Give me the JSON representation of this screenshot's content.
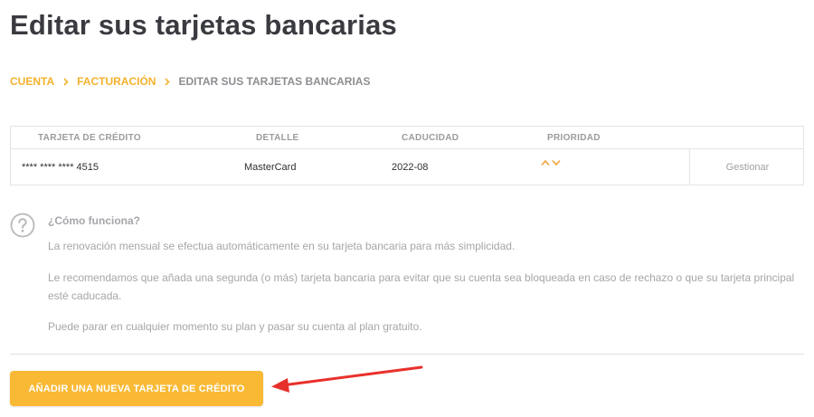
{
  "page": {
    "title": "Editar sus tarjetas bancarias"
  },
  "breadcrumb": {
    "items": [
      {
        "label": "CUENTA"
      },
      {
        "label": "FACTURACIÓN"
      },
      {
        "label": "EDITAR SUS TARJETAS BANCARIAS"
      }
    ]
  },
  "table": {
    "columns": [
      "TARJETA DE CRÉDITO",
      "DETALLE",
      "CADUCIDAD",
      "PRIORIDAD"
    ],
    "rows": [
      {
        "card_number": "**** **** **** 4515",
        "detail": "MasterCard",
        "expiry": "2022-08",
        "manage_label": "Gestionar"
      }
    ]
  },
  "help": {
    "icon": "question-circle-icon",
    "title": "¿Cómo funciona?",
    "paragraphs": [
      "La renovación mensual se efectua automáticamente en su tarjeta bancaria para más simplicidad.",
      "Le recomendamos que añada una segunda (o más) tarjeta bancaria para evitar que su cuenta sea bloqueada en caso de rechazo o que su tarjeta principal esté caducada.",
      "Puede parar en cualquier momento su plan y pasar su cuenta al plan gratuito."
    ]
  },
  "actions": {
    "add_card_label": "AÑADIR UNA NUEVA TARJETA DE CRÉDITO"
  },
  "colors": {
    "accent": "#f9b934",
    "breadcrumb_link": "#f5b12d",
    "priority_arrow": "#f0a23c",
    "annotation_arrow": "#e8302a"
  }
}
